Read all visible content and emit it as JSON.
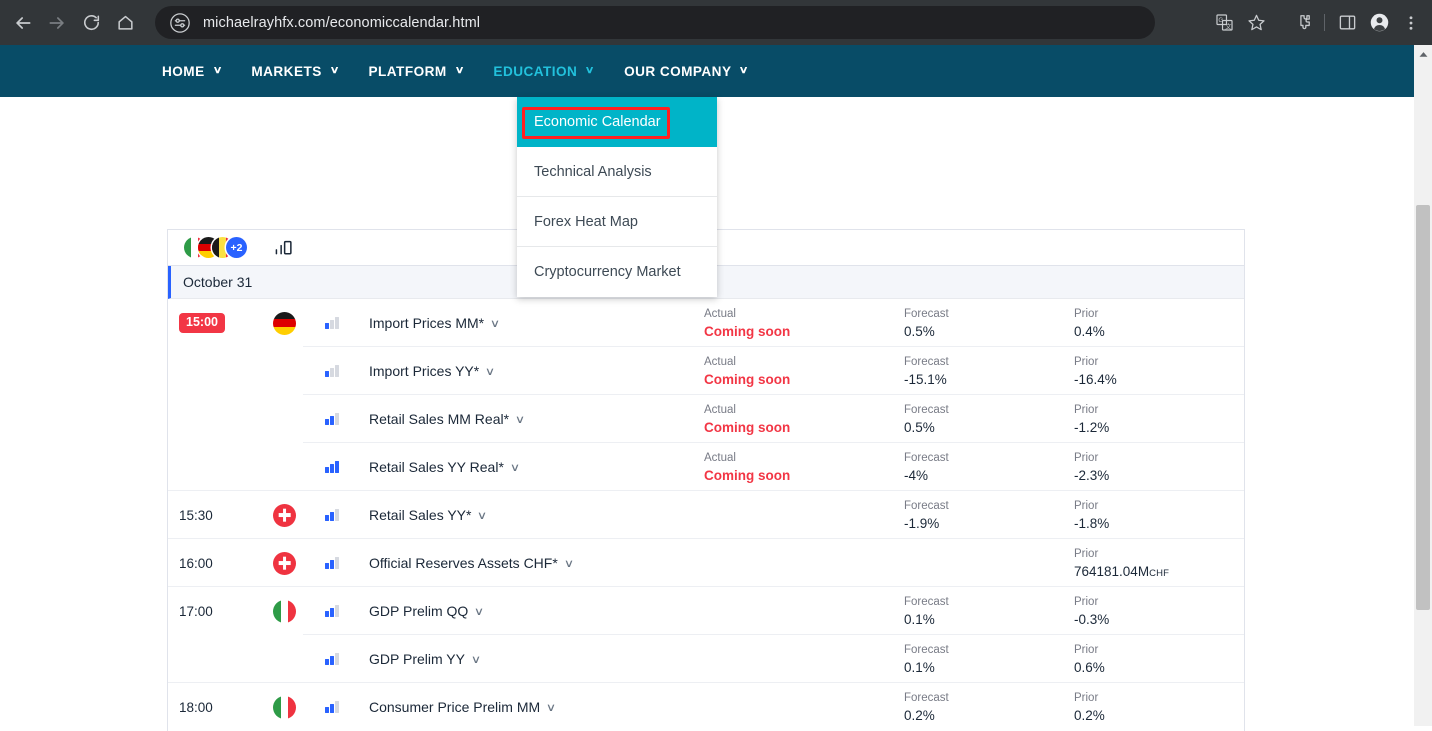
{
  "browser": {
    "url": "michaelrayhfx.com/economiccalendar.html",
    "back_icon": "back-arrow-icon",
    "forward_icon": "forward-arrow-icon",
    "reload_icon": "reload-icon",
    "home_icon": "home-icon",
    "site_settings_icon": "tune-icon",
    "translate_icon": "translate-icon",
    "bookmark_icon": "star-icon",
    "extensions_icon": "puzzle-icon",
    "side_panel_icon": "side-panel-icon",
    "profile_icon": "profile-avatar-icon",
    "menu_icon": "three-dot-menu-icon"
  },
  "site_nav": {
    "items": [
      {
        "label": "HOME",
        "active": false
      },
      {
        "label": "MARKETS",
        "active": false
      },
      {
        "label": "PLATFORM",
        "active": false
      },
      {
        "label": "EDUCATION",
        "active": true
      },
      {
        "label": "OUR COMPANY",
        "active": false
      }
    ],
    "caret": "∨",
    "bg_color": "#084C67",
    "active_color": "#22C1DC"
  },
  "dropdown": {
    "items": [
      {
        "label": "Economic Calendar",
        "highlighted": true
      },
      {
        "label": "Technical Analysis",
        "highlighted": false
      },
      {
        "label": "Forex Heat Map",
        "highlighted": false
      },
      {
        "label": "Cryptocurrency Market",
        "highlighted": false
      }
    ],
    "highlight_color": "#00B4C8",
    "annotation_color": "#FF2020"
  },
  "calendar": {
    "toolbar": {
      "country_flags": [
        "italy",
        "germany",
        "belgium"
      ],
      "more_countries_badge": "+2",
      "importance_filter_icon": "bar-chart-icon"
    },
    "date_header": "October 31",
    "column_labels": {
      "actual": "Actual",
      "forecast": "Forecast",
      "prior": "Prior"
    },
    "rows": [
      {
        "time": "15:00",
        "time_badge": true,
        "flag": "germany",
        "importance": 1,
        "event": "Import Prices MM*",
        "actual_label": "Actual",
        "actual": "Coming soon",
        "actual_soon": true,
        "forecast_label": "Forecast",
        "forecast": "0.5%",
        "prior_label": "Prior",
        "prior": "0.4%"
      },
      {
        "time": "",
        "time_badge": false,
        "flag": "",
        "importance": 1,
        "event": "Import Prices YY*",
        "actual_label": "Actual",
        "actual": "Coming soon",
        "actual_soon": true,
        "forecast_label": "Forecast",
        "forecast": "-15.1%",
        "prior_label": "Prior",
        "prior": "-16.4%"
      },
      {
        "time": "",
        "time_badge": false,
        "flag": "",
        "importance": 2,
        "event": "Retail Sales MM Real*",
        "actual_label": "Actual",
        "actual": "Coming soon",
        "actual_soon": true,
        "forecast_label": "Forecast",
        "forecast": "0.5%",
        "prior_label": "Prior",
        "prior": "-1.2%"
      },
      {
        "time": "",
        "time_badge": false,
        "flag": "",
        "importance": 3,
        "event": "Retail Sales YY Real*",
        "actual_label": "Actual",
        "actual": "Coming soon",
        "actual_soon": true,
        "forecast_label": "Forecast",
        "forecast": "-4%",
        "prior_label": "Prior",
        "prior": "-2.3%"
      },
      {
        "time": "15:30",
        "time_badge": false,
        "flag": "switzerland",
        "importance": 2,
        "event": "Retail Sales YY*",
        "actual_label": "",
        "actual": "",
        "actual_soon": false,
        "forecast_label": "Forecast",
        "forecast": "-1.9%",
        "prior_label": "Prior",
        "prior": "-1.8%"
      },
      {
        "time": "16:00",
        "time_badge": false,
        "flag": "switzerland",
        "importance": 2,
        "event": "Official Reserves Assets CHF*",
        "actual_label": "",
        "actual": "",
        "actual_soon": false,
        "forecast_label": "",
        "forecast": "",
        "prior_label": "Prior",
        "prior": "764181.04M",
        "prior_unit": "CHF"
      },
      {
        "time": "17:00",
        "time_badge": false,
        "flag": "italy",
        "importance": 2,
        "event": "GDP Prelim QQ",
        "actual_label": "",
        "actual": "",
        "actual_soon": false,
        "forecast_label": "Forecast",
        "forecast": "0.1%",
        "prior_label": "Prior",
        "prior": "-0.3%"
      },
      {
        "time": "",
        "time_badge": false,
        "flag": "",
        "importance": 2,
        "event": "GDP Prelim YY",
        "actual_label": "",
        "actual": "",
        "actual_soon": false,
        "forecast_label": "Forecast",
        "forecast": "0.1%",
        "prior_label": "Prior",
        "prior": "0.6%"
      },
      {
        "time": "18:00",
        "time_badge": false,
        "flag": "italy",
        "importance": 2,
        "event": "Consumer Price Prelim MM",
        "actual_label": "",
        "actual": "",
        "actual_soon": false,
        "forecast_label": "Forecast",
        "forecast": "0.2%",
        "prior_label": "Prior",
        "prior": "0.2%"
      }
    ]
  }
}
